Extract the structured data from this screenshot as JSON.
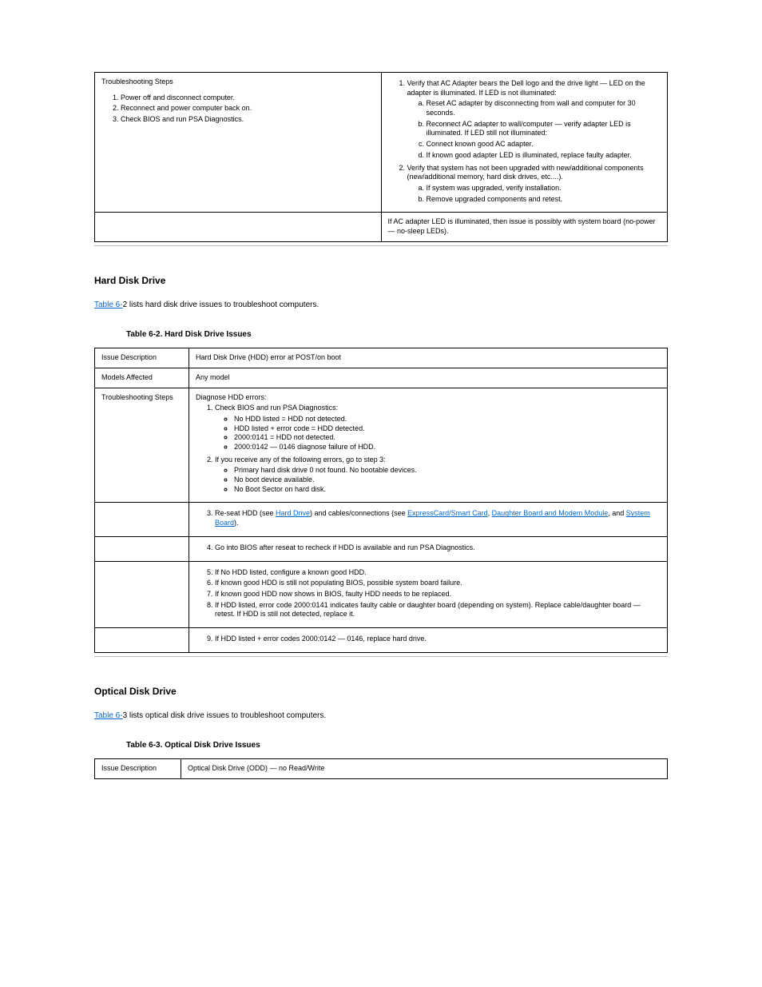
{
  "table1": {
    "rows": [
      {
        "left_label": "Troubleshooting Steps",
        "left_steps": [
          "Power off and disconnect computer.",
          "Reconnect and power computer back on.",
          "Check BIOS and run PSA Diagnostics."
        ],
        "right_1_pre": "Verify that AC Adapter bears the Dell logo and the drive light ",
        "right_1_dash": "—",
        "right_1_post": " LED on the adapter is illuminated. If LED is not illuminated:",
        "right_list_a": [
          "Reset AC adapter by disconnecting from wall and computer for 30 seconds.",
          {
            "pre": "Reconnect AC adapter to wall/computer ",
            "dash": "—",
            "post": " verify adapter LED is illuminated. If LED still not illuminated:"
          },
          "Connect known good AC adapter.",
          "If known good adapter LED is illuminated, replace faulty adapter."
        ],
        "right_2": "Verify that system has not been upgraded with new/additional components (new/additional memory, hard disk drives, etc....).",
        "right_list_b": [
          "If system was upgraded, verify installation.",
          "Remove upgraded components and retest."
        ]
      },
      {
        "left": "",
        "right_pre": "If AC adapter LED is illuminated, then issue is possibly with system board (no-power ",
        "right_dash": "—",
        "right_post": " no-sleep LEDs)."
      }
    ]
  },
  "section_hdd": {
    "heading": "Hard Disk Drive",
    "intro_pre": "Table 6-",
    "intro_post": "2 lists hard disk drive issues to troubleshoot computers.",
    "intro_link": "Table 6-",
    "caption_pre": "Table 6-",
    "caption_post": "2. Hard Disk Drive Issues"
  },
  "table2": {
    "rows": [
      {
        "l": "Issue Description",
        "r": "Hard Disk Drive (HDD) error at POST/on boot"
      },
      {
        "l": "Models Affected",
        "r": "Any model"
      },
      {
        "l": "Troubleshooting Steps",
        "r_lead": "Diagnose HDD errors:",
        "ol": [
          {
            "text": "Check BIOS and run PSA Diagnostics:",
            "ul": [
              "No HDD listed = HDD not detected.",
              "HDD listed + error code = HDD detected.",
              "2000:0141 = HDD not detected.",
              {
                "pre": "2000:0142 ",
                "dash": "—",
                "post": " 0146 diagnose failure of HDD."
              }
            ]
          },
          {
            "text": "If you receive any of the following errors, go to step 3:",
            "ul": [
              "Primary hard disk drive 0 not found. No bootable devices.",
              "No boot device available.",
              "No Boot Sector on hard disk."
            ]
          }
        ]
      },
      {
        "l": "",
        "r_parts": [
          "Re-seat HDD (see ",
          {
            "link": "Hard Drive"
          },
          ") and cables/connections (see ",
          {
            "link": "ExpressCard/Smart Card"
          },
          ", ",
          {
            "link": "Daughter Board and Modem Module"
          },
          ", and ",
          {
            "link": "System Board"
          },
          ")."
        ]
      },
      {
        "l": "",
        "r": "Go into BIOS after reseat to recheck if HDD is available and run PSA Diagnostics."
      },
      {
        "l": "",
        "items": [
          "If No HDD listed, configure a known good HDD.",
          "If known good HDD is still not populating BIOS, possible system board failure.",
          "If known good HDD now shows in BIOS, faulty HDD needs to be replaced.",
          {
            "pre": "If HDD listed, error code 2000:0141 indicates faulty cable or daughter board (depending on system). Replace cable/daughter board ",
            "dash": "—",
            "post": " retest. If HDD is still not detected, replace it."
          }
        ]
      },
      {
        "l": "",
        "r_pre": "If HDD listed + error codes 2000:0142 ",
        "r_dash": "—",
        "r_post": " 0146, replace hard drive."
      }
    ]
  },
  "section_optical": {
    "heading": "Optical Disk Drive",
    "intro_pre": "Table 6-",
    "intro_post": "3 lists optical disk drive issues to troubleshoot computers.",
    "intro_link": "Table 6-",
    "caption_pre": "Table 6-",
    "caption_post": "3. Optical Disk Drive Issues"
  },
  "table3": {
    "rows": [
      {
        "l": "Issue Description",
        "r_pre": "Optical Disk Drive (ODD) ",
        "r_dash": "—",
        "r_post": " no Read/Write"
      }
    ]
  }
}
